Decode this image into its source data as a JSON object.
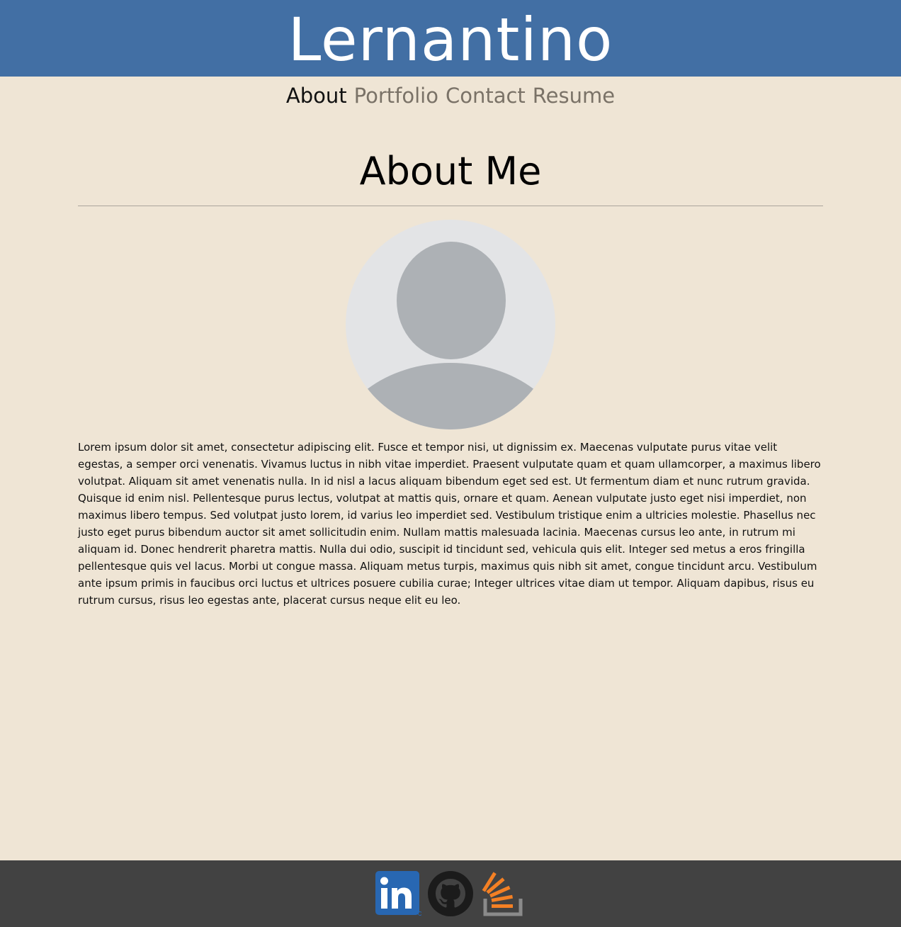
{
  "header": {
    "brand": "Lernantino",
    "bg_color": "#426fa4"
  },
  "nav": {
    "items": [
      {
        "label": "About",
        "active": true
      },
      {
        "label": "Portfolio",
        "active": false
      },
      {
        "label": "Contact",
        "active": false
      },
      {
        "label": "Resume",
        "active": false
      }
    ]
  },
  "about": {
    "title": "About Me",
    "avatar_icon": "default-user-avatar",
    "bio": "Lorem ipsum dolor sit amet, consectetur adipiscing elit. Fusce et tempor nisi, ut dignissim ex. Maecenas vulputate purus vitae velit egestas, a semper orci venenatis. Vivamus luctus in nibh vitae imperdiet. Praesent vulputate quam et quam ullamcorper, a maximus libero volutpat. Aliquam sit amet venenatis nulla. In id nisl a lacus aliquam bibendum eget sed est. Ut fermentum diam et nunc rutrum gravida. Quisque id enim nisl. Pellentesque purus lectus, volutpat at mattis quis, ornare et quam. Aenean vulputate justo eget nisi imperdiet, non maximus libero tempus. Sed volutpat justo lorem, id varius leo imperdiet sed. Vestibulum tristique enim a ultricies molestie. Phasellus nec justo eget purus bibendum auctor sit amet sollicitudin enim. Nullam mattis malesuada lacinia. Maecenas cursus leo ante, in rutrum mi aliquam id. Donec hendrerit pharetra mattis. Nulla dui odio, suscipit id tincidunt sed, vehicula quis elit. Integer sed metus a eros fringilla pellentesque quis vel lacus. Morbi ut congue massa. Aliquam metus turpis, maximus quis nibh sit amet, congue tincidunt arcu. Vestibulum ante ipsum primis in faucibus orci luctus et ultrices posuere cubilia curae; Integer ultrices vitae diam ut tempor. Aliquam dapibus, risus eu rutrum cursus, risus leo egestas ante, placerat cursus neque elit eu leo."
  },
  "footer": {
    "bg_color": "#424242",
    "social_links": [
      {
        "icon": "linkedin-icon",
        "color": "#2867b2"
      },
      {
        "icon": "github-icon",
        "color": "#1b1b1b"
      },
      {
        "icon": "stackoverflow-icon",
        "color": "#f48024"
      }
    ]
  },
  "colors": {
    "page_bg": "#efe5d5",
    "nav_inactive": "#7a7267",
    "nav_active": "#111111"
  }
}
